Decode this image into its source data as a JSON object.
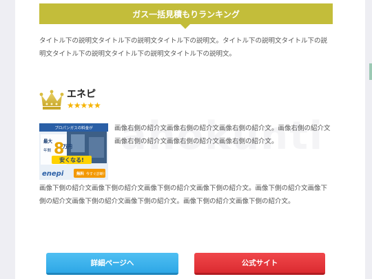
{
  "banner": {
    "title": "ガス一括見積もりランキング"
  },
  "intro": {
    "text": "タイトル下の説明文タイトル下の説明文タイトル下の説明文。タイトル下の説明文タイトル下の説明文タイトル下の説明文タイトル下の説明文タイトル下の説明文。"
  },
  "ranking": {
    "name": "エネピ",
    "stars": "★★★★★",
    "rating": 5,
    "side_text": "画像右側の紹介文画像右側の紹介文画像右側の紹介文。画像右側の紹介文画像右側の紹介文画像右側の紹介文画像右側の紹介文。",
    "below_text": "画像下側の紹介文画像下側の紹介文画像下側の紹介文画像下側の紹介文。画像下側の紹介文画像下側の紹介文画像下側の紹介文画像下側の紹介文。画像下側の紹介文画像下側の紹介文。",
    "thumb": {
      "top_caption": "プロパンガスの料金が",
      "label_small1": "最大",
      "amount": "8",
      "unit": "万円",
      "label_small2": "年間",
      "cheaper": "安くなる!",
      "brand": "enepi",
      "cta": "無料",
      "cta2": "今すぐ診断!"
    }
  },
  "buttons": {
    "detail": "詳細ページへ",
    "official": "公式サイト"
  },
  "colors": {
    "banner": "#c3bd3a",
    "detail_button": "#2ea7e6",
    "official_button": "#db2b30",
    "stars": "#f5b301"
  }
}
